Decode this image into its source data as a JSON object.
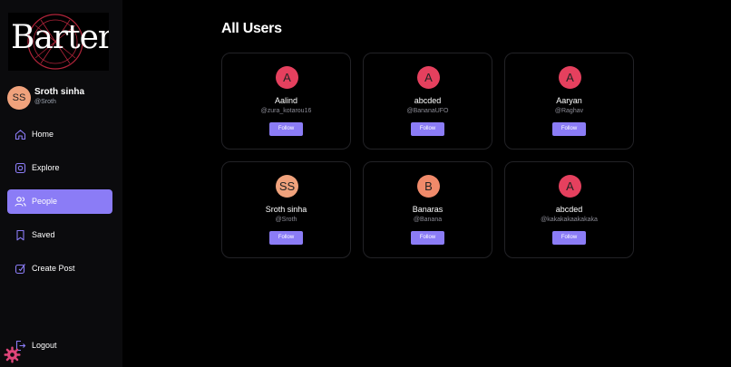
{
  "brand": {
    "name": "Barter"
  },
  "profile": {
    "initials": "SS",
    "name": "Sroth sinha",
    "handle": "@Sroth"
  },
  "nav": [
    {
      "label": "Home",
      "icon": "home-icon",
      "active": false
    },
    {
      "label": "Explore",
      "icon": "explore-icon",
      "active": false
    },
    {
      "label": "People",
      "icon": "people-icon",
      "active": true
    },
    {
      "label": "Saved",
      "icon": "saved-icon",
      "active": false
    },
    {
      "label": "Create Post",
      "icon": "create-post-icon",
      "active": false
    }
  ],
  "logout": {
    "label": "Logout",
    "icon": "logout-icon"
  },
  "page": {
    "title": "All Users"
  },
  "users": [
    {
      "initials": "A",
      "name": "Aalind",
      "handle": "@zura_kotarou16",
      "follow_label": "Follow",
      "avatar_color": "#e5405e"
    },
    {
      "initials": "A",
      "name": "abcded",
      "handle": "@BananaUFO",
      "follow_label": "Follow",
      "avatar_color": "#e5405e"
    },
    {
      "initials": "A",
      "name": "Aaryan",
      "handle": "@Raghav",
      "follow_label": "Follow",
      "avatar_color": "#e5405e"
    },
    {
      "initials": "SS",
      "name": "Sroth sinha",
      "handle": "@Sroth",
      "follow_label": "Follow",
      "avatar_color": "#f0a27c"
    },
    {
      "initials": "B",
      "name": "Banaras",
      "handle": "@Banana",
      "follow_label": "Follow",
      "avatar_color": "#f08a6a"
    },
    {
      "initials": "A",
      "name": "abcded",
      "handle": "@kakakakaakakaka",
      "follow_label": "Follow",
      "avatar_color": "#e5405e"
    }
  ],
  "colors": {
    "accent": "#8b7cf6",
    "sidebar_bg": "#0b0b0d",
    "background": "#000000"
  }
}
